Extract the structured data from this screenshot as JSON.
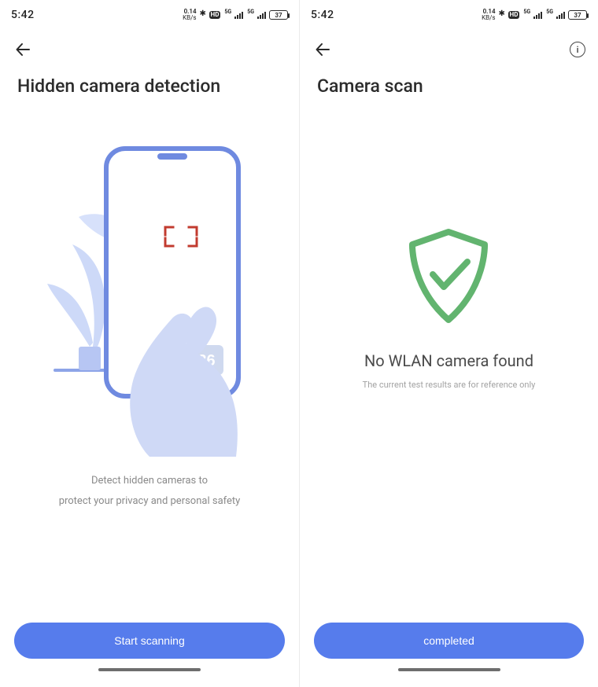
{
  "statusbar": {
    "time": "5:42",
    "net_rate_top": "0.14",
    "net_rate_bottom": "KB/s",
    "hd_label": "HD",
    "net1_label": "5G",
    "net2_label": "5G",
    "battery_pct": "37"
  },
  "left": {
    "title": "Hidden camera detection",
    "illustration_time": "02:36",
    "desc_line1": "Detect hidden cameras to",
    "desc_line2": "protect your privacy and personal safety",
    "cta_label": "Start scanning"
  },
  "right": {
    "title": "Camera scan",
    "result_title": "No WLAN camera found",
    "result_sub": "The current test results are for reference only",
    "cta_label": "completed",
    "info_glyph": "i"
  },
  "colors": {
    "accent": "#567cec",
    "success": "#62b46f",
    "muted": "#8a8a8a"
  }
}
